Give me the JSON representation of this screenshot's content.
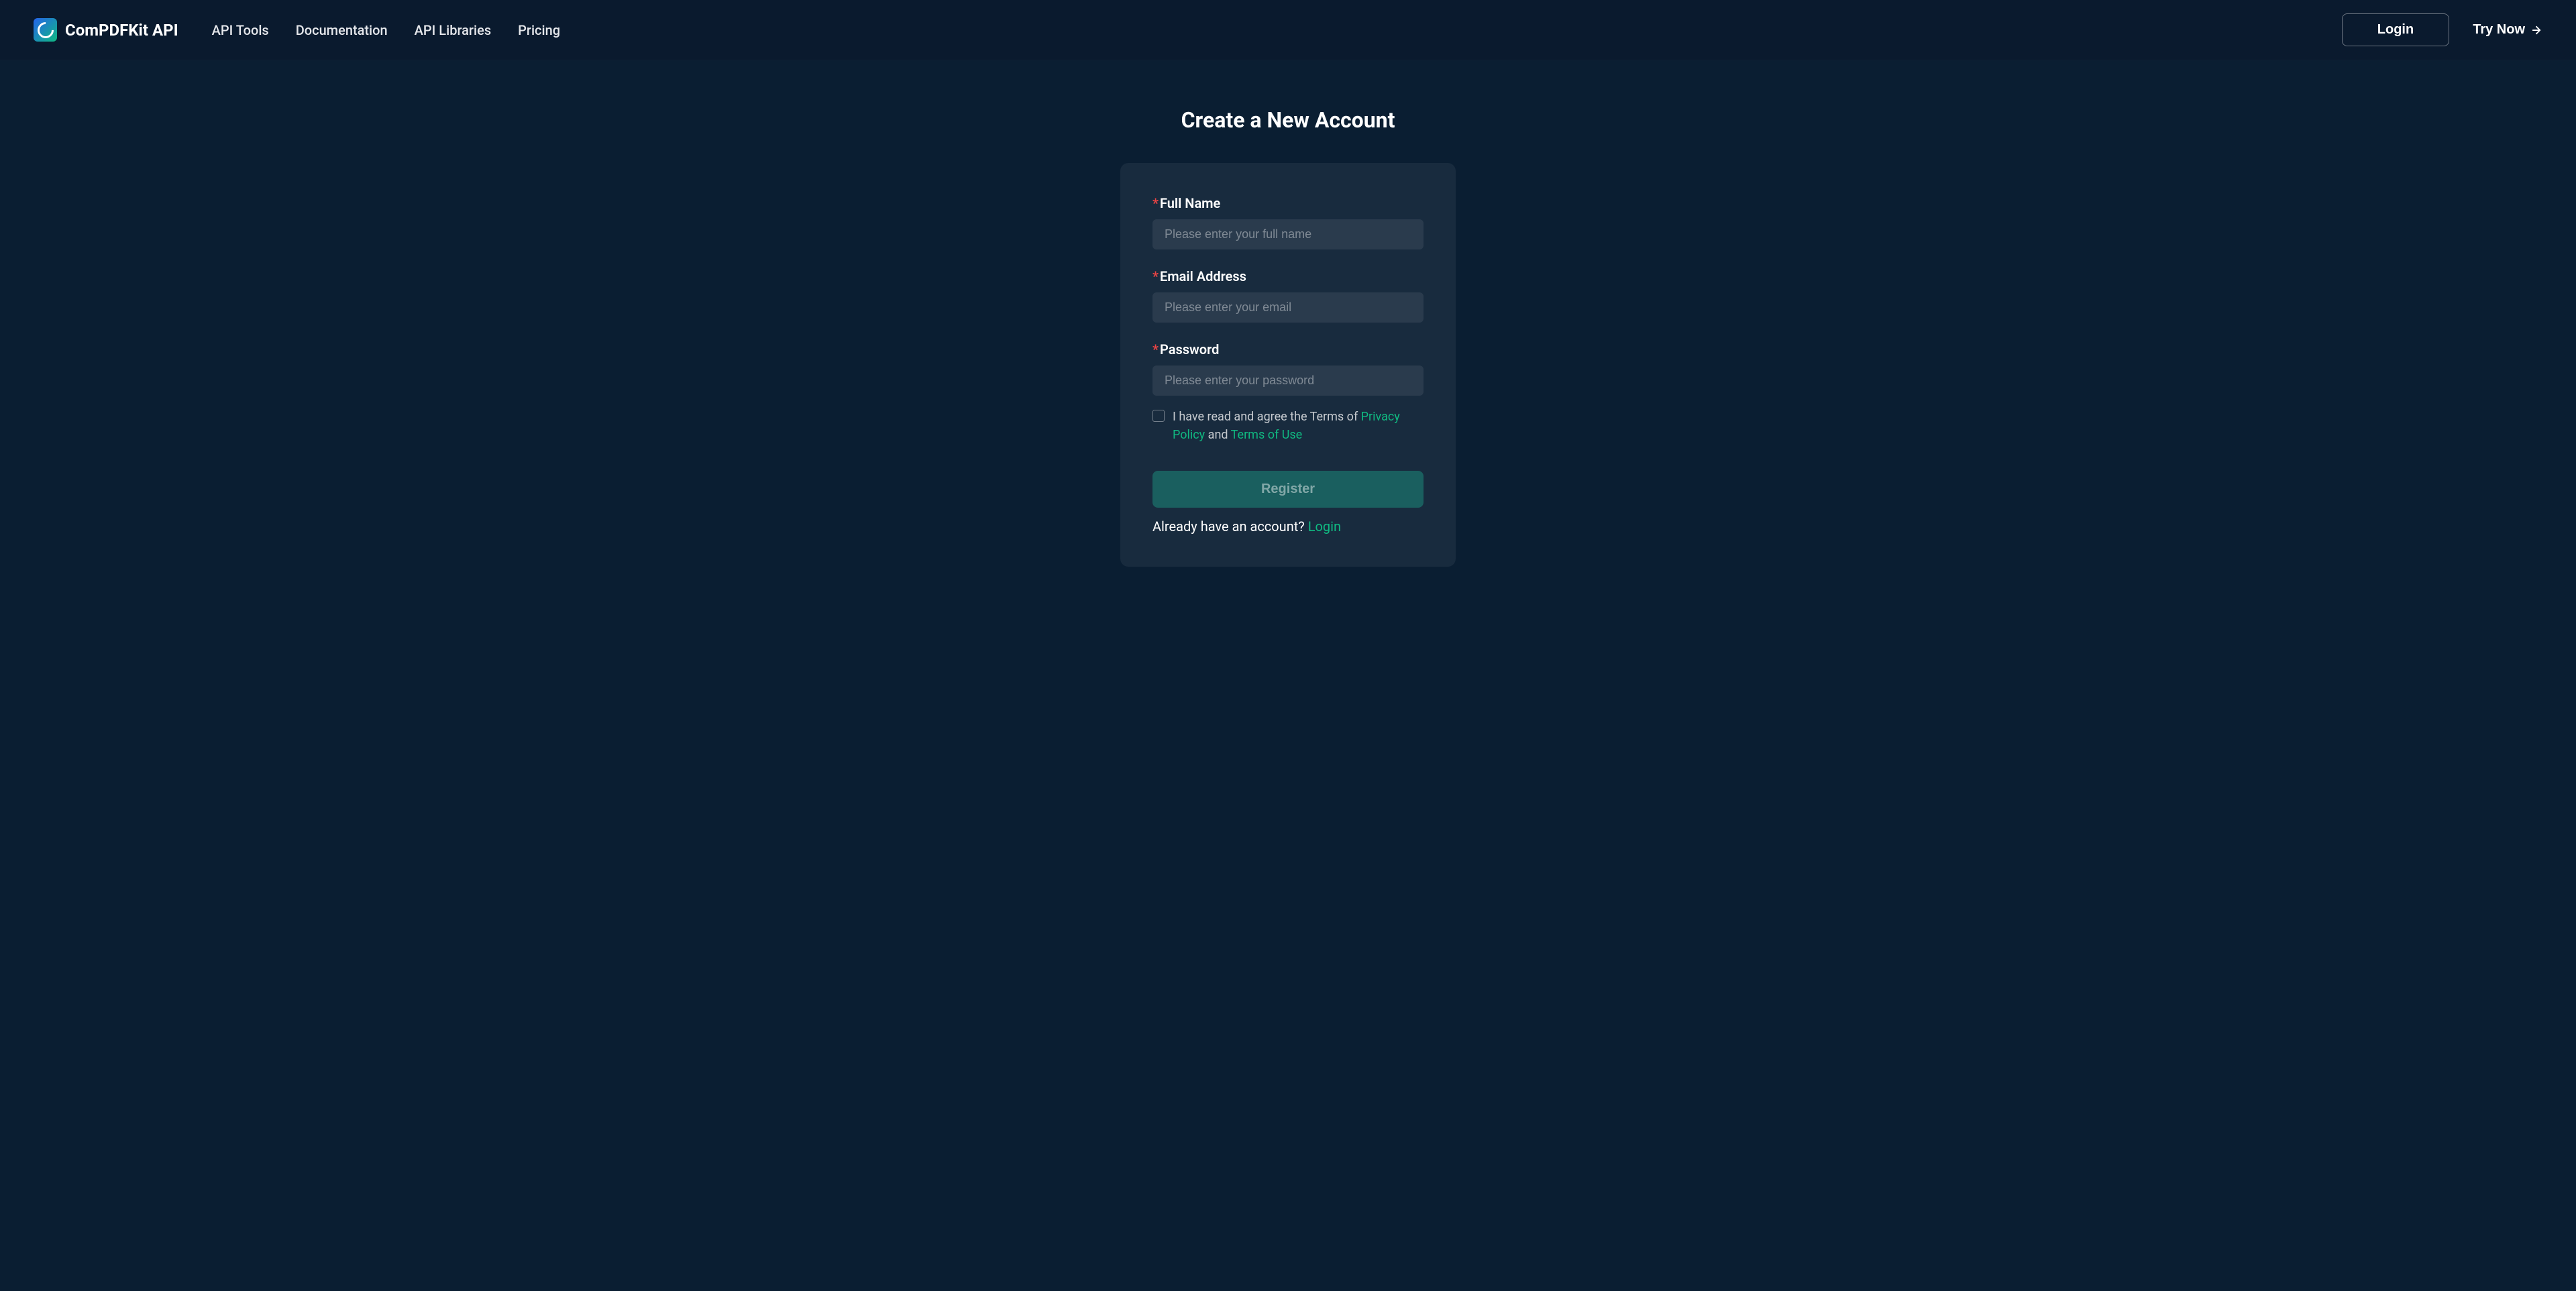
{
  "header": {
    "logo_text": "ComPDFKit API",
    "nav": {
      "api_tools": "API Tools",
      "documentation": "Documentation",
      "api_libraries": "API Libraries",
      "pricing": "Pricing"
    },
    "login_button": "Login",
    "try_now_button": "Try Now"
  },
  "main": {
    "title": "Create a New Account",
    "form": {
      "full_name": {
        "label": "Full Name",
        "placeholder": "Please enter your full name"
      },
      "email": {
        "label": "Email Address",
        "placeholder": "Please enter your email"
      },
      "password": {
        "label": "Password",
        "placeholder": "Please enter your password"
      },
      "agreement": {
        "prefix": "I have read and agree the Terms of ",
        "privacy_policy": "Privacy Policy",
        "and": " and ",
        "terms_of_use": "Terms of Use"
      },
      "register_button": "Register",
      "login_prompt": "Already have an account? ",
      "login_link": "Login"
    }
  }
}
